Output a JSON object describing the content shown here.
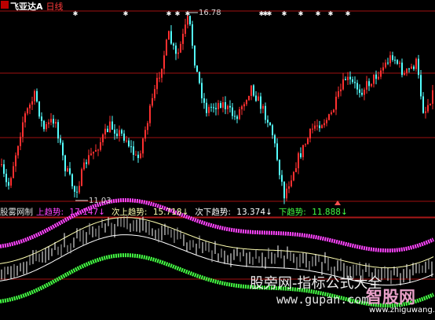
{
  "header": {
    "stock_name": "飞亚达A",
    "period": "日线"
  },
  "price_annotations": {
    "high_label": "16.78",
    "low_label": "11.03"
  },
  "indicator": {
    "name": "股雾网制",
    "items": [
      {
        "label": "上趋势:",
        "value": "17.147↓",
        "color": "#ff44ff"
      },
      {
        "label": "次上趋势:",
        "value": "15.718↓",
        "color": "#ffffb0"
      },
      {
        "label": "次下趋势:",
        "value": "13.374↓",
        "color": "#ffffff"
      },
      {
        "label": "下趋势:",
        "value": "11.888↓",
        "color": "#44ff44"
      }
    ]
  },
  "watermark": {
    "line1": "股旁网-指标公式大全",
    "line2": "www.gupan.com",
    "brand": "智股网",
    "brand_url": "www.zhiguwang.com"
  },
  "colors": {
    "up": "#ff3030",
    "down": "#54ffff",
    "grid": "#a01010",
    "upper_band": "#ff44ff",
    "mid_upper": "#ffffb0",
    "mid_lower": "#ffffff",
    "lower_band": "#44ff44"
  },
  "chart_data": {
    "type": "candlestick",
    "price_high": 16.78,
    "price_low": 11.03
  }
}
